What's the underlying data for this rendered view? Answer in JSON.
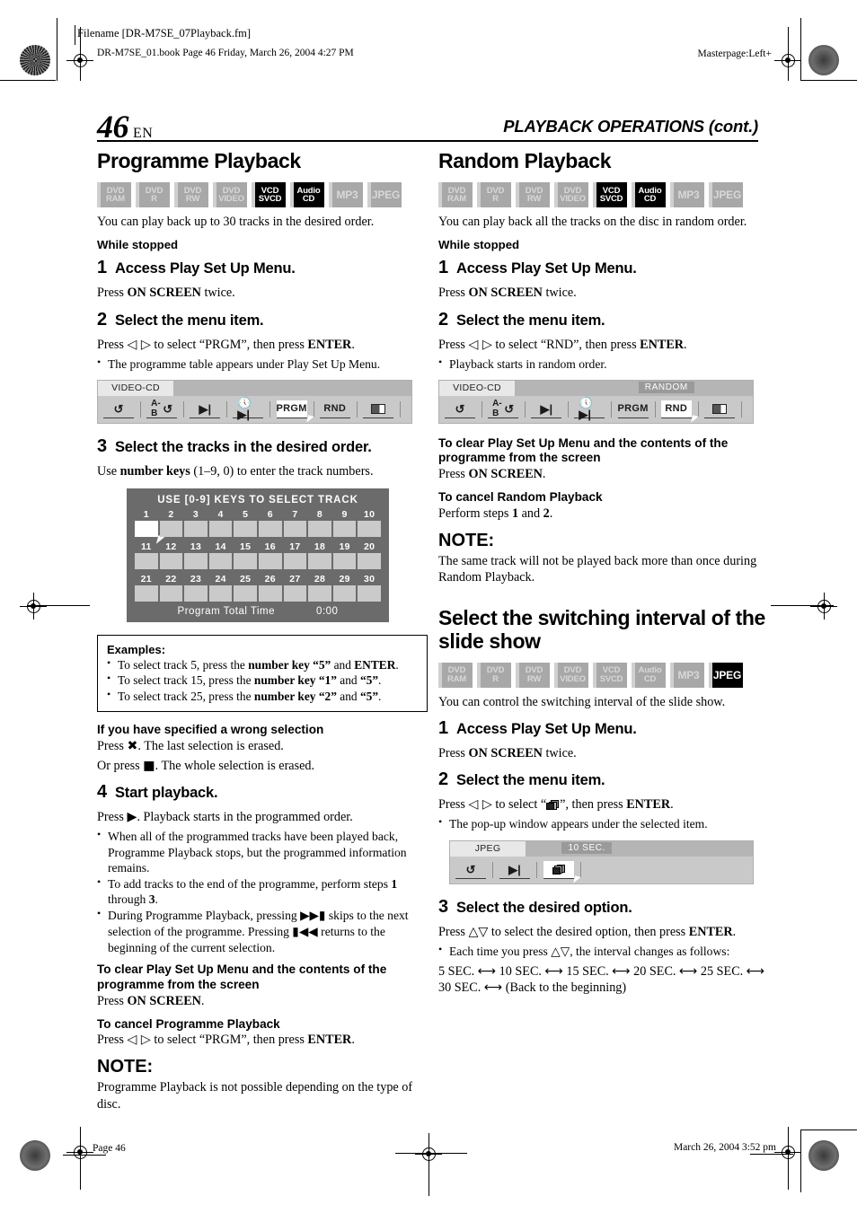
{
  "meta": {
    "filename": "Filename [DR-M7SE_07Playback.fm]",
    "bookline": "DR-M7SE_01.book  Page 46  Friday, March 26, 2004  4:27 PM",
    "masterpage": "Masterpage:Left+",
    "footer_page": "Page 46",
    "footer_date": "March 26, 2004 3:52 pm"
  },
  "header": {
    "page_number": "46",
    "page_lang": "EN",
    "running_head": "PLAYBACK OPERATIONS (cont.)"
  },
  "badge_labels": {
    "dvd_ram": [
      "DVD",
      "RAM"
    ],
    "dvd_r": [
      "DVD",
      "R"
    ],
    "dvd_rw": [
      "DVD",
      "RW"
    ],
    "dvd_video": [
      "DVD",
      "VIDEO"
    ],
    "vcd_svcd": [
      "VCD",
      "SVCD"
    ],
    "audio_cd": [
      "Audio",
      "CD"
    ],
    "mp3": "MP3",
    "jpeg": "JPEG"
  },
  "programme": {
    "title": "Programme Playback",
    "badge_states": [
      "off",
      "off",
      "off",
      "off",
      "on",
      "on",
      "off",
      "off"
    ],
    "intro": "You can play back up to 30 tracks in the desired order.",
    "condition": "While stopped",
    "step1": {
      "num": "1",
      "title": "Access Play Set Up Menu.",
      "body_html": "Press <b>ON SCREEN</b> twice."
    },
    "step2": {
      "num": "2",
      "title": "Select the menu item.",
      "body_html": "Press <span class=\"sym\">&#9665; &#9655;</span> to select &#8220;PRGM&#8221;, then press <b>ENTER</b>.",
      "bullet": "The programme table appears under Play Set Up Menu."
    },
    "osd": {
      "tab": "VIDEO-CD",
      "mode_label": "",
      "buttons": [
        "repeat",
        "A-B",
        "skip",
        "time-skip",
        "PRGM",
        "RND",
        "screen"
      ],
      "selected": "PRGM"
    },
    "step3": {
      "num": "3",
      "title": "Select the tracks in the desired order.",
      "body_html": "Use <b>number keys</b> (1&#8211;9, 0) to enter the track numbers."
    },
    "track_table": {
      "title": "USE [0-9] KEYS TO SELECT TRACK",
      "numbers": [
        1,
        2,
        3,
        4,
        5,
        6,
        7,
        8,
        9,
        10,
        11,
        12,
        13,
        14,
        15,
        16,
        17,
        18,
        19,
        20,
        21,
        22,
        23,
        24,
        25,
        26,
        27,
        28,
        29,
        30
      ],
      "active_cell": 1,
      "total_time_label": "Program Total Time",
      "total_time_value": "0:00"
    },
    "examples": {
      "title": "Examples:",
      "items_html": [
        "To select track 5, press the <b>number key &#8220;5&#8221;</b> and <b>ENTER</b>.",
        "To select track 15, press the <b>number key &#8220;1&#8221;</b> and <b>&#8220;5&#8221;</b>.",
        "To select track 25, press the <b>number key &#8220;2&#8221;</b> and <b>&#8220;5&#8221;</b>."
      ]
    },
    "wrong_selection": {
      "heading": "If you have specified a wrong selection",
      "line1_html": "Press <span class=\"sym\">&#10006;</span>. The last selection is erased.",
      "line2_html": "Or press <span class=\"sym\">&#9632;</span>. The whole selection is erased."
    },
    "step4": {
      "num": "4",
      "title": "Start playback.",
      "body_html": "Press <span class=\"sym\">&#9654;</span>. Playback starts in the programmed order.",
      "bullets_html": [
        "When all of the programmed tracks have been played back, Programme Playback stops, but the programmed information remains.",
        "To add tracks to the end of the programme, perform steps <b>1</b> through <b>3</b>.",
        "During Programme Playback, pressing <span class=\"sym\">&#9654;&#9654;&#9646;</span> skips to the next selection of the programme. Pressing <span class=\"sym\">&#9646;&#9664;&#9664;</span> returns to the beginning of the current selection."
      ]
    },
    "clear_menu": {
      "heading": "To clear Play Set Up Menu and the contents of the programme from the screen",
      "body_html": "Press <b>ON SCREEN</b>."
    },
    "cancel": {
      "heading": "To cancel Programme Playback",
      "body_html": "Press <span class=\"sym\">&#9665; &#9655;</span> to select &#8220;PRGM&#8221;, then press <b>ENTER</b>."
    },
    "note": {
      "heading": "NOTE:",
      "body": "Programme Playback is not possible depending on the type of disc."
    }
  },
  "random": {
    "title": "Random Playback",
    "badge_states": [
      "off",
      "off",
      "off",
      "off",
      "on",
      "on",
      "off",
      "off"
    ],
    "intro": "You can play back all the tracks on the disc in random order.",
    "condition": "While stopped",
    "step1": {
      "num": "1",
      "title": "Access Play Set Up Menu.",
      "body_html": "Press <b>ON SCREEN</b> twice."
    },
    "step2": {
      "num": "2",
      "title": "Select the menu item.",
      "body_html": "Press <span class=\"sym\">&#9665; &#9655;</span> to select &#8220;RND&#8221;, then press <b>ENTER</b>.",
      "bullet": "Playback starts in random order."
    },
    "osd": {
      "tab": "VIDEO-CD",
      "mode_label": "RANDOM",
      "buttons": [
        "repeat",
        "A-B",
        "skip",
        "time-skip",
        "PRGM",
        "RND",
        "screen"
      ],
      "selected": "RND"
    },
    "clear_menu": {
      "heading": "To clear Play Set Up Menu and the contents of the programme from the screen",
      "body_html": "Press <b>ON SCREEN</b>."
    },
    "cancel": {
      "heading": "To cancel Random Playback",
      "body_html": "Perform steps <b>1</b> and <b>2</b>."
    },
    "note": {
      "heading": "NOTE:",
      "body": "The same track will not be played back more than once during Random Playback."
    }
  },
  "slideshow": {
    "title": "Select the switching interval of the slide show",
    "badge_states": [
      "off",
      "off",
      "off",
      "off",
      "off",
      "off",
      "off",
      "on"
    ],
    "intro": "You can control the switching interval of the slide show.",
    "step1": {
      "num": "1",
      "title": "Access Play Set Up Menu.",
      "body_html": "Press <b>ON SCREEN</b> twice."
    },
    "step2": {
      "num": "2",
      "title": "Select the menu item.",
      "body_html": "Press <span class=\"sym\">&#9665; &#9655;</span> to select &#8220;<span class=\"slideicon\"><i></i><i></i><i></i></span>&#8221;, then press <b>ENTER</b>.",
      "bullet": "The pop-up window appears under the selected item."
    },
    "osd": {
      "tab": "JPEG",
      "mode_label": "10 SEC.",
      "buttons": [
        "repeat",
        "skip",
        "slideshow"
      ],
      "selected": "slideshow"
    },
    "step3": {
      "num": "3",
      "title": "Select the desired option.",
      "body_html": "Press <span class=\"sym\">&#9651;&#9661;</span> to select the desired option, then press <b>ENTER</b>.",
      "bullet_html": "Each time you press <span class=\"sym\">&#9651;&#9661;</span>, the interval changes as follows:",
      "sequence_html": "5 SEC. <span class=\"sym\">&#10231;</span> 10 SEC. <span class=\"sym\">&#10231;</span> 15 SEC. <span class=\"sym\">&#10231;</span> 20 SEC. <span class=\"sym\">&#10231;</span> 25 SEC. <span class=\"sym\">&#10231;</span> 30 SEC. <span class=\"sym\">&#10231;</span> (Back to the beginning)"
    }
  }
}
